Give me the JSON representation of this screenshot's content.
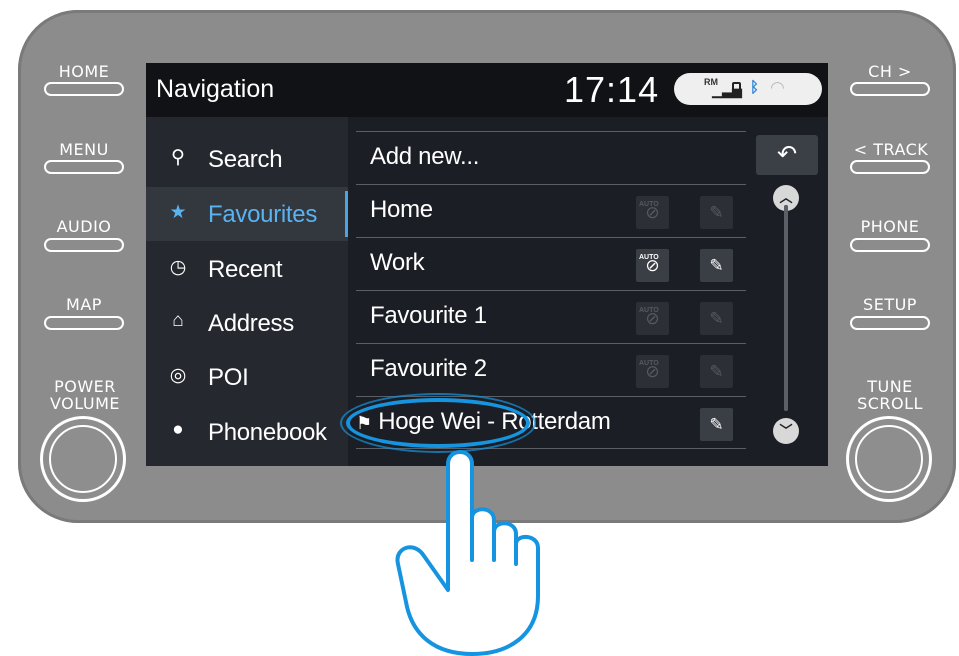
{
  "hardware": {
    "left_buttons": [
      "HOME",
      "MENU",
      "AUDIO",
      "MAP"
    ],
    "left_knob_label": "POWER\nVOLUME",
    "right_buttons": [
      "CH >",
      "< TRACK",
      "PHONE",
      "SETUP"
    ],
    "right_knob_label": "TUNE\nSCROLL"
  },
  "screen": {
    "title": "Navigation",
    "clock": "17:14",
    "status": {
      "carrier": "RM",
      "signal_icon": "signal-bars-icon",
      "battery_icon": "battery-icon",
      "bluetooth_icon": "bluetooth-icon",
      "wifi_icon": "wifi-icon"
    }
  },
  "sidebar": {
    "items": [
      {
        "label": "Search",
        "icon": "search-icon"
      },
      {
        "label": "Favourites",
        "icon": "star-icon",
        "active": true
      },
      {
        "label": "Recent",
        "icon": "clock-icon"
      },
      {
        "label": "Address",
        "icon": "address-icon"
      },
      {
        "label": "POI",
        "icon": "pin-icon"
      },
      {
        "label": "Phonebook",
        "icon": "person-icon"
      }
    ],
    "accent_color": "#5ab3f0"
  },
  "favourites": {
    "add_new": "Add new...",
    "rows": [
      {
        "label": "Home",
        "auto_label": "AUTO",
        "enabled": false
      },
      {
        "label": "Work",
        "auto_label": "AUTO",
        "enabled": true
      },
      {
        "label": "Favourite 1",
        "auto_label": "AUTO",
        "enabled": false
      },
      {
        "label": "Favourite 2",
        "auto_label": "AUTO",
        "enabled": false
      },
      {
        "label": "Hoge Wei - Rotterdam",
        "enabled": true
      }
    ]
  },
  "controls": {
    "back_icon": "back-arrow-icon",
    "scroll_up_icon": "chevron-up-icon",
    "scroll_down_icon": "chevron-down-icon"
  },
  "overlay": {
    "highlight_color": "#1694e0",
    "hand_icon": "pointing-hand-icon"
  }
}
